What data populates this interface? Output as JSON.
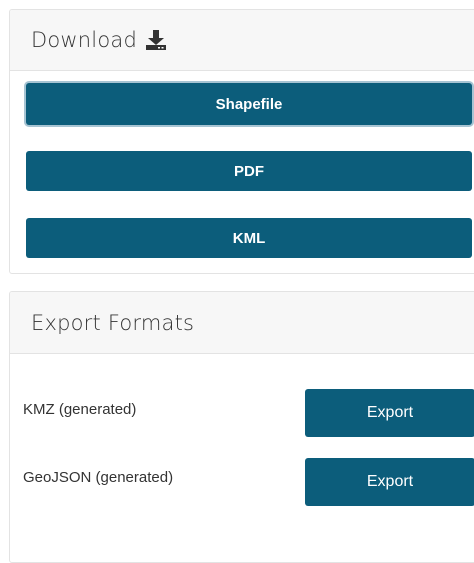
{
  "download": {
    "title": "Download",
    "icon": "download-icon",
    "buttons": [
      "Shapefile",
      "PDF",
      "KML"
    ]
  },
  "export": {
    "title": "Export Formats",
    "rows": [
      {
        "label": "KMZ (generated)",
        "button": "Export"
      },
      {
        "label": "GeoJSON (generated)",
        "button": "Export"
      }
    ]
  },
  "colors": {
    "button": "#0c5d7b",
    "header_bg": "#f7f7f7",
    "border": "#e3e3e3"
  }
}
